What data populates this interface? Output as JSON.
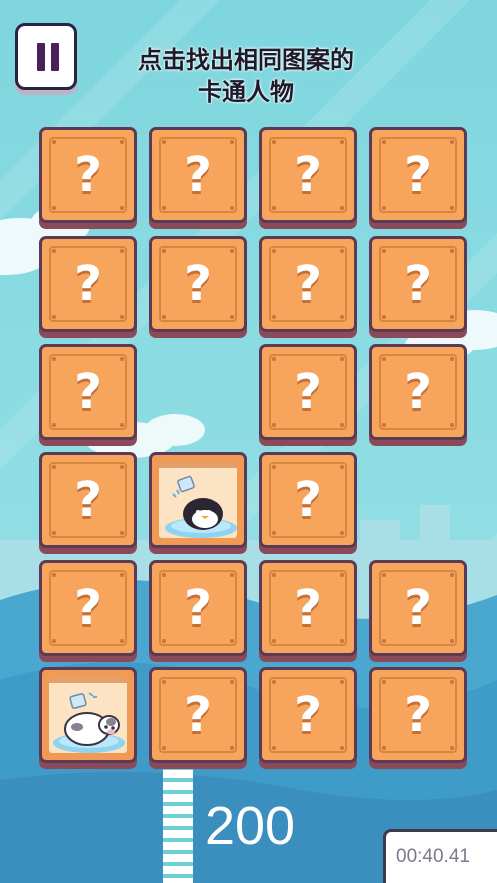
{
  "hud": {
    "instruction_line1": "点击找出相同图案的",
    "instruction_line2": "卡通人物",
    "score": "200",
    "timer": "00:40.41"
  },
  "board": {
    "rows": [
      [
        "closed",
        "closed",
        "closed",
        "closed"
      ],
      [
        "closed",
        "closed",
        "closed",
        "closed"
      ],
      [
        "closed",
        "empty",
        "closed",
        "closed"
      ],
      [
        "closed",
        "penguin",
        "closed",
        "empty"
      ],
      [
        "closed",
        "closed",
        "closed",
        "closed"
      ],
      [
        "cow",
        "closed",
        "closed",
        "closed"
      ]
    ],
    "mystery_symbol": "?"
  },
  "colors": {
    "sky": "#7fd9e0",
    "tile_face": "#f7a45d",
    "tile_border": "#5b3a55",
    "ground": "#3f9bc8"
  },
  "icons": {
    "pause": "pause-icon",
    "penguin": "penguin-icon",
    "cow": "cow-icon"
  }
}
